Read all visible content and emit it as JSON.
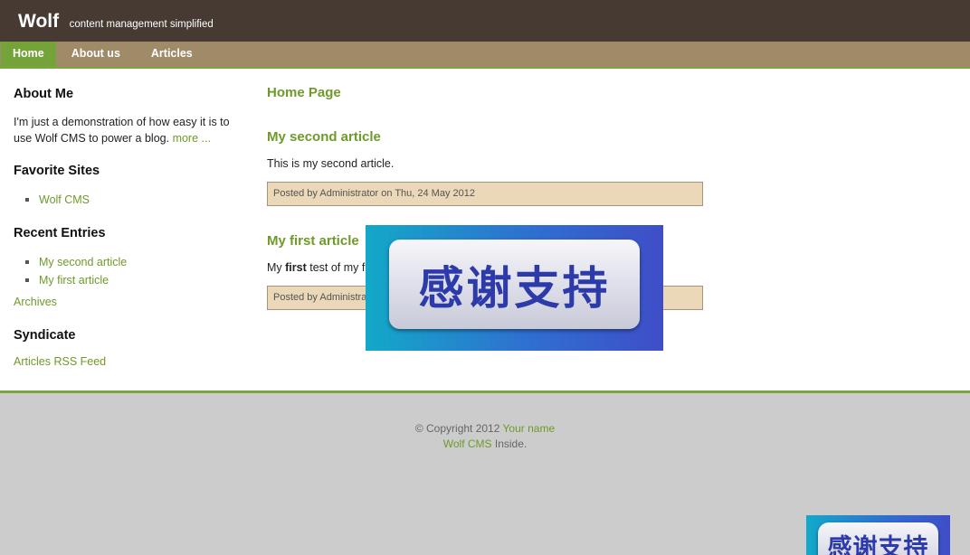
{
  "header": {
    "site_title": "Wolf",
    "slogan": "content management simplified"
  },
  "nav": {
    "items": [
      {
        "label": "Home",
        "current": true
      },
      {
        "label": "About us",
        "current": false
      },
      {
        "label": "Articles",
        "current": false
      }
    ]
  },
  "sidebar": {
    "about": {
      "title": "About Me",
      "text": "I'm just a demonstration of how easy it is to use Wolf CMS to power a blog.",
      "more_link": "more ..."
    },
    "favorite_sites": {
      "title": "Favorite Sites",
      "items": [
        "Wolf CMS"
      ]
    },
    "recent_entries": {
      "title": "Recent Entries",
      "items": [
        "My second article",
        "My first article"
      ],
      "archives_link": "Archives"
    },
    "syndicate": {
      "title": "Syndicate",
      "rss_link": "Articles RSS Feed"
    }
  },
  "content": {
    "page_title": "Home Page",
    "articles": [
      {
        "title": "My second article",
        "body": "This is my second article.",
        "info": "Posted by Administrator on Thu, 24 May 2012"
      },
      {
        "title": "My first article",
        "body_prefix": "My ",
        "body_bold": "first",
        "body_suffix": " test of my first article.",
        "info": "Posted by Administrator on Thu, 24 May 2012"
      }
    ]
  },
  "footer": {
    "copyright": "© Copyright 2012 ",
    "your_name_link": "Your name",
    "wolf_link": "Wolf CMS",
    "inside_text": " Inside."
  },
  "overlay_banners": [
    {
      "text": "感谢支持"
    },
    {
      "text": "感谢支持"
    }
  ],
  "colors": {
    "header_bg": "#463a33",
    "nav_bg": "#a08b69",
    "nav_current_bg": "#74a33a",
    "link_green": "#6f9a2a",
    "footer_bg": "#cccccc",
    "article_info_bg": "#ead8b8"
  }
}
